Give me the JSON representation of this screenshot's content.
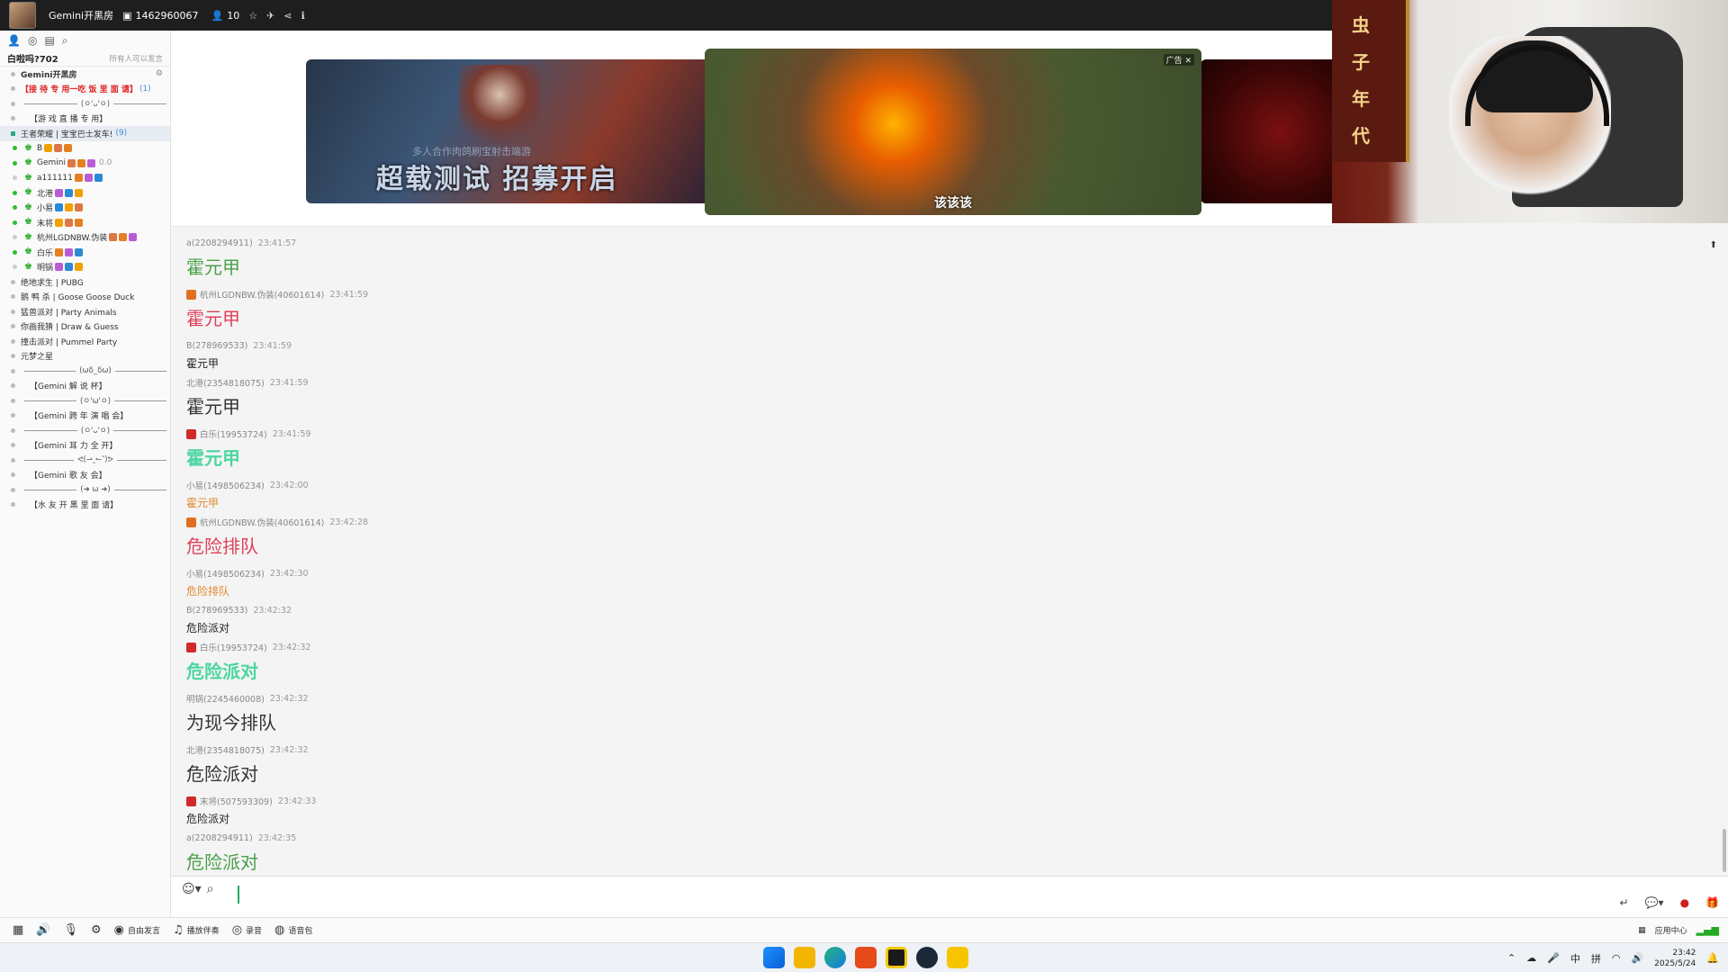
{
  "titlebar": {
    "room_name": "Gemini开黑房",
    "room_id": "1462960067",
    "online_count": "10"
  },
  "sidebar": {
    "header_title": "白啦吗?702",
    "header_note": "所有人可以发言",
    "root": "Gemini开黑房",
    "channels_top": [
      {
        "label": "【接 待 专 用一吃 饭 里 面 请】",
        "extra": "(1)",
        "style": "red"
      },
      {
        "label": "(ㅇ'ᴗ'ㅇ)",
        "style": "divider"
      },
      {
        "label": "【游 戏 直 播 专 用】",
        "style": "center"
      }
    ],
    "active_channel": {
      "label": "王者荣耀 | 宝宝巴士发车!",
      "count": "(9)"
    },
    "users": [
      {
        "name": "B",
        "online": true,
        "extra": ""
      },
      {
        "name": "Gemini",
        "online": true,
        "extra": "0.0"
      },
      {
        "name": "a111111",
        "online": false,
        "extra": ""
      },
      {
        "name": "北港",
        "online": true,
        "extra": ""
      },
      {
        "name": "小易",
        "online": true,
        "extra": ""
      },
      {
        "name": "末将",
        "online": true,
        "extra": ""
      },
      {
        "name": "杭州LGDNBW.伪装",
        "online": false,
        "extra": ""
      },
      {
        "name": "白乐",
        "online": true,
        "extra": ""
      },
      {
        "name": "明锅",
        "online": false,
        "extra": ""
      }
    ],
    "channels_bottom": [
      {
        "label": "绝地求生 | PUBG",
        "style": "normal"
      },
      {
        "label": "鹅 鸭 杀 | Goose Goose Duck",
        "style": "normal"
      },
      {
        "label": "猛兽派对 | Party Animals",
        "style": "normal"
      },
      {
        "label": "你画我猜 | Draw & Guess",
        "style": "normal"
      },
      {
        "label": "撞击派对 | Pummel Party",
        "style": "normal"
      },
      {
        "label": "元梦之星",
        "style": "normal"
      },
      {
        "label": "(ωδ_δω)",
        "style": "divider"
      },
      {
        "label": "【Gemini 解 说 杯】",
        "style": "center"
      },
      {
        "label": "(ㅇ'ω'ㅇ)",
        "style": "divider"
      },
      {
        "label": "【Gemini 跨 年 演 唱 会】",
        "style": "center"
      },
      {
        "label": "(ㅇ'ᴗ'ㅇ)",
        "style": "divider"
      },
      {
        "label": "【Gemini 耳 力 全 开】",
        "style": "center"
      },
      {
        "label": "ᕙ(⇀‸↼‶)ᕗ",
        "style": "divider"
      },
      {
        "label": "【Gemini 歌 友 会】",
        "style": "center"
      },
      {
        "label": "(➜ ω ➜)",
        "style": "divider"
      },
      {
        "label": "【水 友 开 黑 里 面 请】",
        "style": "center"
      }
    ]
  },
  "banner": {
    "left_slogan": "超载测试 招募开启",
    "left_sub": "多人合作肉鸽刷宝射击端游",
    "center_caption": "该该该",
    "center_ad": "广告"
  },
  "webcam": {
    "cloth_text": [
      "虫",
      "子",
      "年",
      "代"
    ]
  },
  "chat": {
    "messages": [
      {
        "user": "a(2208294911)",
        "time": "23:41:57",
        "text": "霍元甲",
        "color": "#4a9f4a",
        "size": 20,
        "bold": false,
        "icon": ""
      },
      {
        "user": "杭州LGDNBW.伪装(40601614)",
        "time": "23:41:59",
        "text": "霍元甲",
        "color": "#e0405a",
        "size": 20,
        "bold": false,
        "icon": "#e07020"
      },
      {
        "user": "B(278969533)",
        "time": "23:41:59",
        "text": "霍元甲",
        "color": "#222222",
        "size": 12,
        "bold": false,
        "icon": ""
      },
      {
        "user": "北港(2354818075)",
        "time": "23:41:59",
        "text": "霍元甲",
        "color": "#333333",
        "size": 20,
        "bold": false,
        "icon": ""
      },
      {
        "user": "白乐(19953724)",
        "time": "23:41:59",
        "text": "霍元甲",
        "color": "#4cd6a0",
        "size": 20,
        "bold": true,
        "icon": "#d02a2a"
      },
      {
        "user": "小易(1498506234)",
        "time": "23:42:00",
        "text": "霍元甲",
        "color": "#e08a30",
        "size": 12,
        "bold": false,
        "icon": ""
      },
      {
        "user": "杭州LGDNBW.伪装(40601614)",
        "time": "23:42:28",
        "text": "危险排队",
        "color": "#e0405a",
        "size": 20,
        "bold": false,
        "icon": "#e07020"
      },
      {
        "user": "小易(1498506234)",
        "time": "23:42:30",
        "text": "危险排队",
        "color": "#e08a30",
        "size": 12,
        "bold": false,
        "icon": ""
      },
      {
        "user": "B(278969533)",
        "time": "23:42:32",
        "text": "危险派对",
        "color": "#222222",
        "size": 12,
        "bold": false,
        "icon": ""
      },
      {
        "user": "白乐(19953724)",
        "time": "23:42:32",
        "text": "危险派对",
        "color": "#4cd6a0",
        "size": 20,
        "bold": true,
        "icon": "#d02a2a"
      },
      {
        "user": "明锅(2245460008)",
        "time": "23:42:32",
        "text": "为现今排队",
        "color": "#333333",
        "size": 20,
        "bold": false,
        "icon": ""
      },
      {
        "user": "北港(2354818075)",
        "time": "23:42:32",
        "text": "危险派对",
        "color": "#333333",
        "size": 20,
        "bold": false,
        "icon": ""
      },
      {
        "user": "末将(507593309)",
        "time": "23:42:33",
        "text": "危险派对",
        "color": "#222222",
        "size": 12,
        "bold": false,
        "icon": "#d02a2a"
      },
      {
        "user": "a(2208294911)",
        "time": "23:42:35",
        "text": "危险派对",
        "color": "#4a9f4a",
        "size": 20,
        "bold": false,
        "icon": ""
      }
    ]
  },
  "voicebar": {
    "free_speak": "自由发言",
    "play_music": "播放伴奏",
    "record": "录音",
    "voice_pack": "语音包",
    "app_center": "应用中心"
  },
  "taskbar": {
    "ime_lang": "中",
    "ime_mode": "拼",
    "time": "23:42",
    "date": "2025/5/24"
  }
}
